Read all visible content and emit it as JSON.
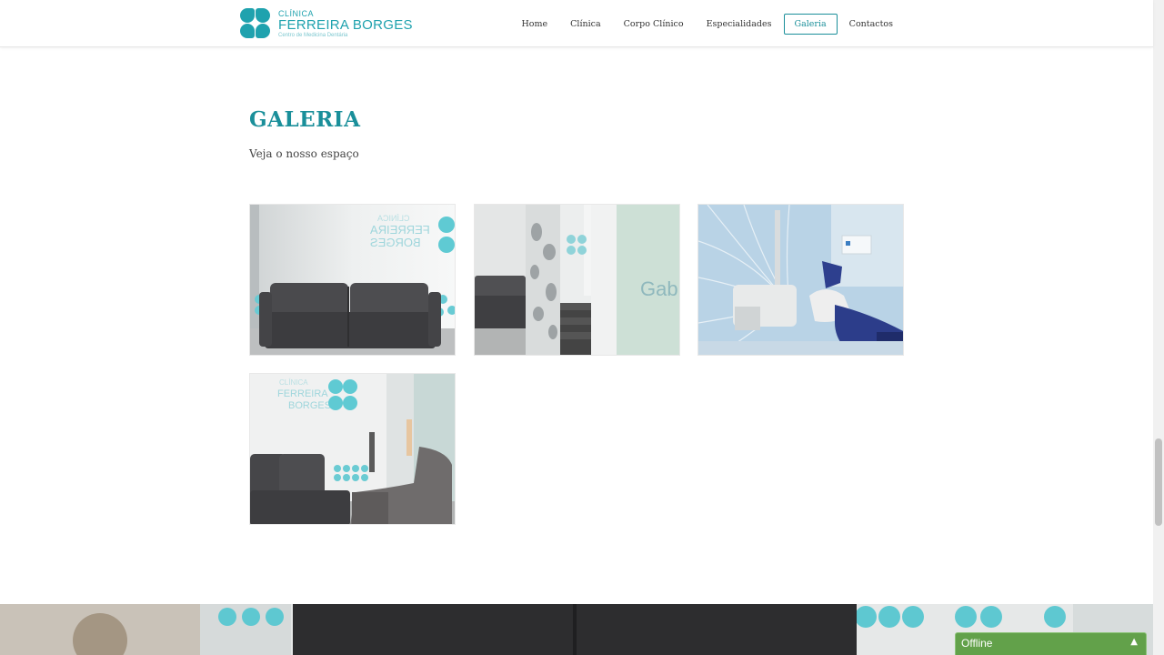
{
  "logo": {
    "top_text": "CLÍNICA",
    "name": "FERREIRA BORGES",
    "tagline": "Centro de Medicina Dentária"
  },
  "nav": {
    "items": [
      {
        "label": "Home"
      },
      {
        "label": "Clínica"
      },
      {
        "label": "Corpo Clínico"
      },
      {
        "label": "Especialidades"
      },
      {
        "label": "Galeria",
        "active": true
      },
      {
        "label": "Contactos"
      }
    ]
  },
  "gallery": {
    "title": "GALERIA",
    "subtitle": "Veja o nosso espaço",
    "images": [
      {
        "description": "waiting-room-sofa"
      },
      {
        "description": "corridor-stairs"
      },
      {
        "description": "dental-chair-room"
      },
      {
        "description": "waiting-room-chairs"
      }
    ],
    "visible_wall_text": "Gabin"
  },
  "chat": {
    "status": "Offline",
    "icon": "chevron-up-icon"
  },
  "colors": {
    "accent": "#1a8f9a",
    "logo": "#1fa2ae",
    "chat_bg": "#62a14a"
  }
}
